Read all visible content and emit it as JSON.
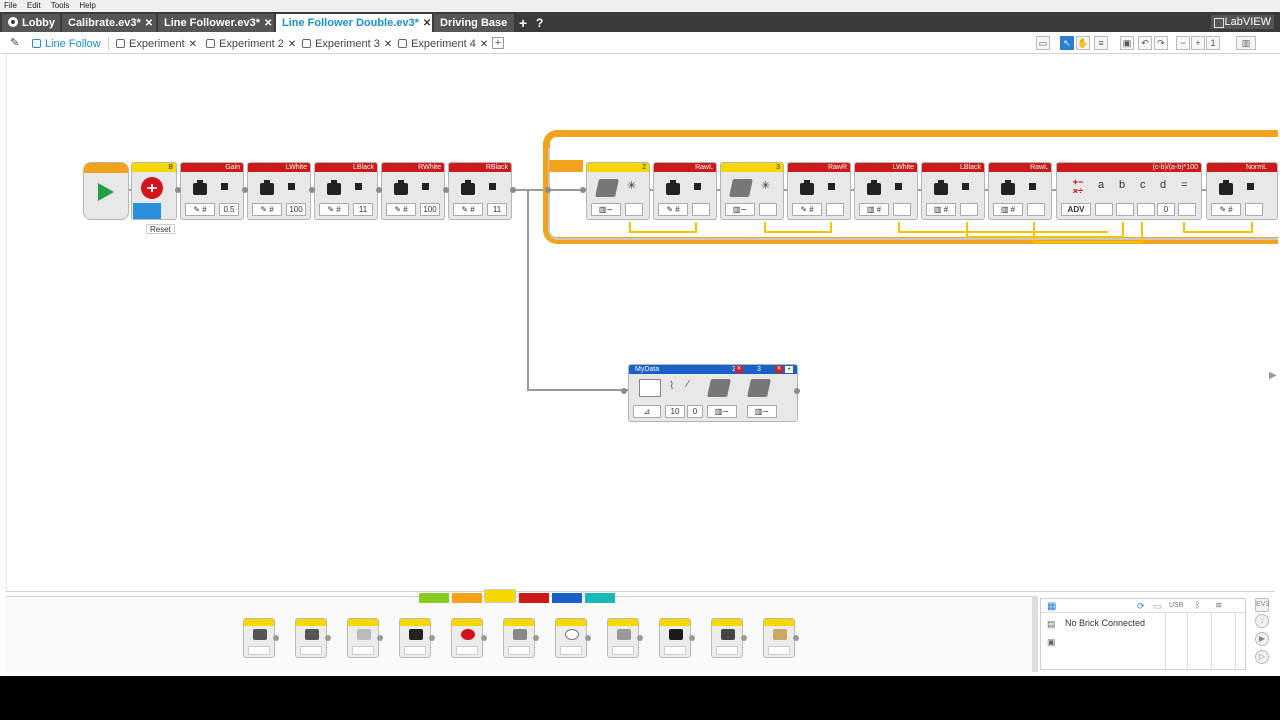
{
  "menu": [
    "File",
    "Edit",
    "Tools",
    "Help"
  ],
  "project_tabs": [
    {
      "label": "Lobby",
      "closable": false
    },
    {
      "label": "Calibrate.ev3*",
      "closable": true
    },
    {
      "label": "Line Follower.ev3*",
      "closable": true
    },
    {
      "label": "Line Follower Double.ev3*",
      "closable": true,
      "active": true
    },
    {
      "label": "Driving Base",
      "closable": false
    }
  ],
  "project_add": "+",
  "project_help": "?",
  "brand": "LabVIEW",
  "program_tabs": [
    {
      "label": "Line Follow",
      "active": true
    },
    {
      "label": "Experiment"
    },
    {
      "label": "Experiment 2"
    },
    {
      "label": "Experiment 3"
    },
    {
      "label": "Experiment 4"
    }
  ],
  "program_add": "+",
  "blocks": {
    "reset_port": "B",
    "reset_tooltip": "Reset",
    "var_gain": {
      "name": "Gain",
      "value": "0.5"
    },
    "var_lwhite": {
      "name": "LWhite",
      "value": "100"
    },
    "var_lblack": {
      "name": "LBlack",
      "value": "11"
    },
    "var_rwhite": {
      "name": "RWhite",
      "value": "100"
    },
    "var_rblack": {
      "name": "RBlack",
      "value": "11"
    },
    "sensor1_port": "2",
    "var_rawl": "RawL",
    "sensor2_port": "3",
    "var_rawr": "RawR",
    "var_lwhite2": "LWhite",
    "var_lblack2": "LBlack",
    "var_rawl2": "RawL",
    "math_expr": "(c-b)/(a-b)*100",
    "math_mode": "ADV",
    "math_inputs": [
      "a",
      "b",
      "c",
      "d",
      "="
    ],
    "math_d_value": "0",
    "var_norml": "NormL",
    "datalog_name": "MyData",
    "datalog_port_1": "2",
    "datalog_port_2": "3",
    "datalog_rate": "10",
    "datalog_val": "0"
  },
  "hardware": {
    "status": "No Brick Connected",
    "usb_label": "USB"
  },
  "colors": {
    "accent": "#1a8fd0",
    "flow_orange": "#f3a21b",
    "data_red": "#cc1a1a",
    "sensor_yellow": "#f5d800",
    "advanced_blue": "#1960c8",
    "action_green": "#88cc22",
    "myblocks_teal": "#18b8b8"
  }
}
